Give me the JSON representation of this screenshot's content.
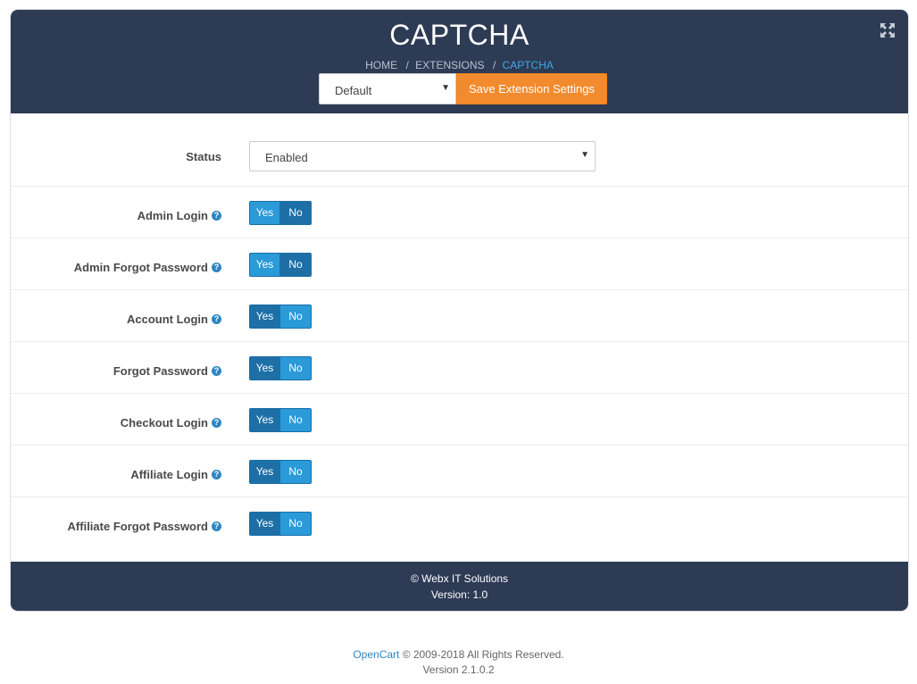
{
  "header": {
    "title": "CAPTCHA",
    "breadcrumb": [
      {
        "label": "HOME"
      },
      {
        "label": "EXTENSIONS"
      },
      {
        "label": "CAPTCHA"
      }
    ],
    "breadcrumb_separator": "/",
    "store_select": {
      "value": "Default"
    },
    "save_label": "Save Extension Settings",
    "icons": {
      "expand": "expand-icon",
      "caret": "caret-down-icon"
    }
  },
  "form": {
    "status": {
      "label": "Status",
      "value": "Enabled"
    },
    "toggles": [
      {
        "label": "Admin Login",
        "yes": "Yes",
        "no": "No",
        "selected": "no"
      },
      {
        "label": "Admin Forgot Password",
        "yes": "Yes",
        "no": "No",
        "selected": "no"
      },
      {
        "label": "Account Login",
        "yes": "Yes",
        "no": "No",
        "selected": "yes"
      },
      {
        "label": "Forgot Password",
        "yes": "Yes",
        "no": "No",
        "selected": "yes"
      },
      {
        "label": "Checkout Login",
        "yes": "Yes",
        "no": "No",
        "selected": "yes"
      },
      {
        "label": "Affiliate Login",
        "yes": "Yes",
        "no": "No",
        "selected": "yes"
      },
      {
        "label": "Affiliate Forgot Password",
        "yes": "Yes",
        "no": "No",
        "selected": "yes"
      }
    ],
    "help_icon": "?"
  },
  "panel_footer": {
    "copyright": "© Webx IT Solutions",
    "version": "Version: 1.0"
  },
  "page_footer": {
    "link": "OpenCart",
    "text": " © 2009-2018 All Rights Reserved.",
    "version": "Version 2.1.0.2"
  },
  "colors": {
    "header_bg": "#2d3b55",
    "save_button": "#f28b2e",
    "toggle_active": "#1d6fa6",
    "toggle_inactive": "#2a9ad8",
    "breadcrumb_current": "#3fa7e6"
  }
}
